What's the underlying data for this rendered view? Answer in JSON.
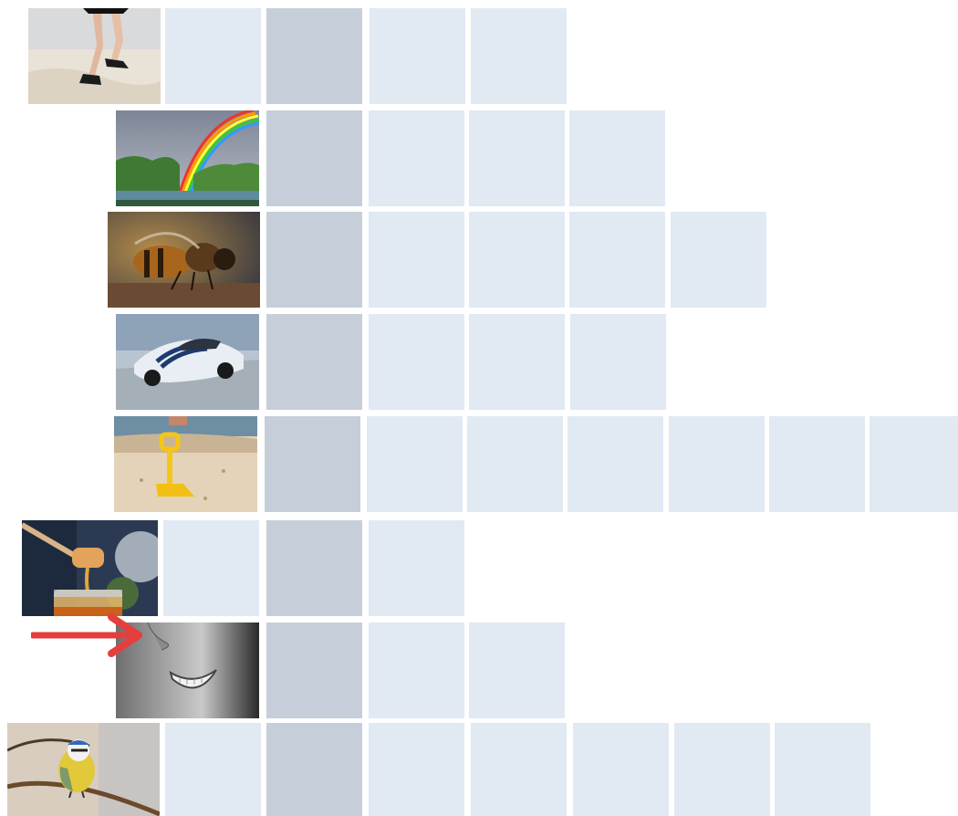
{
  "colors": {
    "empty_cell": "#e1e9f3",
    "key_cell": "#c6cfd9",
    "arrow": "#e53e3e",
    "background": "#ffffff"
  },
  "rows": [
    {
      "image": "running-legs-on-beach",
      "empty_cells": 4
    },
    {
      "image": "rainbow-over-river",
      "empty_cells": 4
    },
    {
      "image": "bee-closeup",
      "empty_cells": 5
    },
    {
      "image": "white-sports-car",
      "empty_cells": 4
    },
    {
      "image": "yellow-toy-shovel-in-sand",
      "empty_cells": 7
    },
    {
      "image": "honey-dipper-and-jar",
      "empty_cells": 3
    },
    {
      "image": "smiling-face-black-white",
      "empty_cells": 3,
      "pointed_by_arrow": true
    },
    {
      "image": "blue-tit-on-branch",
      "empty_cells": 7
    }
  ],
  "icons": {
    "pointer": "right-arrow-icon"
  }
}
